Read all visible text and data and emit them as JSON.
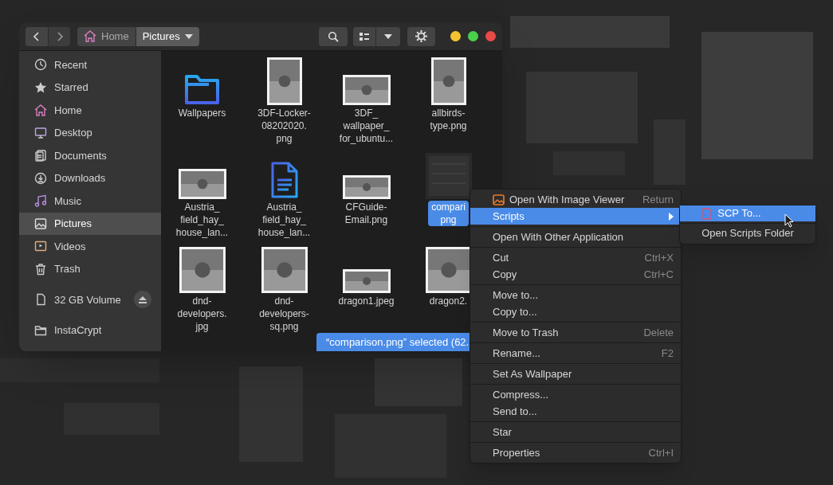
{
  "window": {
    "path": [
      {
        "label": "Home",
        "selected": false
      },
      {
        "label": "Pictures",
        "selected": true
      }
    ]
  },
  "sidebar": {
    "items": [
      {
        "label": "Recent",
        "selected": false
      },
      {
        "label": "Starred",
        "selected": false
      },
      {
        "label": "Home",
        "selected": false
      },
      {
        "label": "Desktop",
        "selected": false
      },
      {
        "label": "Documents",
        "selected": false
      },
      {
        "label": "Downloads",
        "selected": false
      },
      {
        "label": "Music",
        "selected": false
      },
      {
        "label": "Pictures",
        "selected": true
      },
      {
        "label": "Videos",
        "selected": false
      },
      {
        "label": "Trash",
        "selected": false
      }
    ],
    "devices": [
      {
        "label": "32 GB Volume",
        "kind": "drive"
      },
      {
        "label": "InstaCrypt",
        "kind": "folder"
      }
    ]
  },
  "files": [
    {
      "lines": [
        "Wallpapers"
      ],
      "kind": "folder",
      "selected": false
    },
    {
      "lines": [
        "3DF-Locker-",
        "08202020.",
        "png"
      ],
      "kind": "portrait",
      "selected": false
    },
    {
      "lines": [
        "3DF_",
        "wallpaper_",
        "for_ubuntu..."
      ],
      "kind": "landscape",
      "selected": false
    },
    {
      "lines": [
        "allbirds-",
        "type.png"
      ],
      "kind": "portrait",
      "selected": false
    },
    {
      "lines": [
        "Austria_",
        "field_hay_",
        "house_lan..."
      ],
      "kind": "landscape",
      "selected": false
    },
    {
      "lines": [
        "Austria_",
        "field_hay_",
        "house_lan..."
      ],
      "kind": "document",
      "selected": false
    },
    {
      "lines": [
        "CFGuide-",
        "Email.png"
      ],
      "kind": "wide",
      "selected": false
    },
    {
      "lines": [
        "compari",
        "png"
      ],
      "kind": "hidden",
      "selected": true
    },
    {
      "lines": [
        "dnd-",
        "developers.",
        "jpg"
      ],
      "kind": "square",
      "selected": false
    },
    {
      "lines": [
        "dnd-",
        "developers-",
        "sq.png"
      ],
      "kind": "square",
      "selected": false
    },
    {
      "lines": [
        "dragon1.jpeg"
      ],
      "kind": "wide",
      "selected": false
    },
    {
      "lines": [
        "dragon2."
      ],
      "kind": "square",
      "selected": false
    }
  ],
  "status_bar": "“comparison.png” selected (62.",
  "menu": {
    "sections": [
      [
        {
          "label": "Open With Image Viewer",
          "shortcut": "Return",
          "has_icon": true,
          "selected": false,
          "submenu": false
        },
        {
          "label": "Scripts",
          "has_icon": false,
          "selected": true,
          "submenu": true
        }
      ],
      [
        {
          "label": "Open With Other Application",
          "has_icon": false,
          "selected": false,
          "submenu": false
        }
      ],
      [
        {
          "label": "Cut",
          "shortcut": "Ctrl+X",
          "has_icon": false,
          "selected": false,
          "submenu": false
        },
        {
          "label": "Copy",
          "shortcut": "Ctrl+C",
          "has_icon": false,
          "selected": false,
          "submenu": false
        }
      ],
      [
        {
          "label": "Move to...",
          "has_icon": false,
          "selected": false,
          "submenu": false
        },
        {
          "label": "Copy to...",
          "has_icon": false,
          "selected": false,
          "submenu": false
        }
      ],
      [
        {
          "label": "Move to Trash",
          "shortcut": "Delete",
          "has_icon": false,
          "selected": false,
          "submenu": false
        }
      ],
      [
        {
          "label": "Rename...",
          "shortcut": "F2",
          "has_icon": false,
          "selected": false,
          "submenu": false
        }
      ],
      [
        {
          "label": "Set As Wallpaper",
          "has_icon": false,
          "selected": false,
          "submenu": false
        }
      ],
      [
        {
          "label": "Compress...",
          "has_icon": false,
          "selected": false,
          "submenu": false
        },
        {
          "label": "Send to...",
          "has_icon": false,
          "selected": false,
          "submenu": false
        }
      ],
      [
        {
          "label": "Star",
          "has_icon": false,
          "selected": false,
          "submenu": false
        }
      ],
      [
        {
          "label": "Properties",
          "shortcut": "Ctrl+I",
          "has_icon": false,
          "selected": false,
          "submenu": false
        }
      ]
    ]
  },
  "submenu": {
    "items": [
      {
        "label": "SCP To...",
        "has_icon": true,
        "selected": true
      },
      {
        "label": "Open Scripts Folder",
        "has_icon": false,
        "selected": false
      }
    ]
  }
}
